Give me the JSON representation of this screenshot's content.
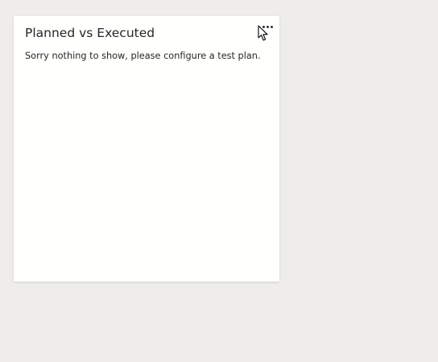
{
  "widget": {
    "title": "Planned vs Executed",
    "message": "Sorry nothing to show, please configure a test plan.",
    "more_icon": "more-horizontal-icon"
  },
  "cursor": {
    "icon": "mouse-pointer-icon"
  },
  "colors": {
    "background": "#eeedec",
    "card": "#fffffd",
    "text": "#262626"
  }
}
